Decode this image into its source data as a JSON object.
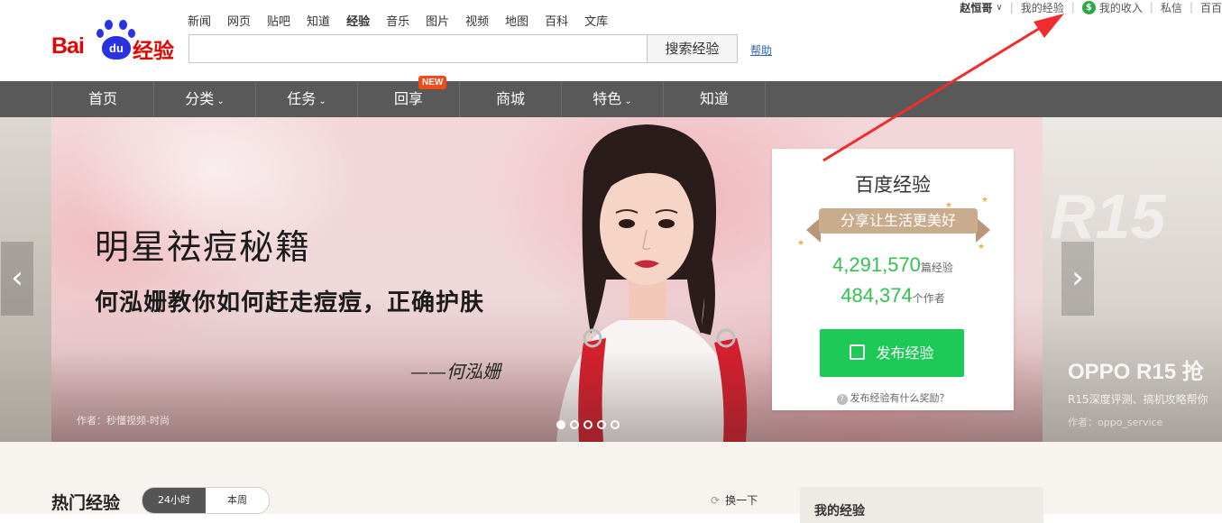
{
  "header": {
    "logo": {
      "part1": "Bai",
      "part2": "du",
      "part3": "经验"
    },
    "top_nav": [
      "新闻",
      "网页",
      "贴吧",
      "知道",
      "经验",
      "音乐",
      "图片",
      "视频",
      "地图",
      "百科",
      "文库"
    ],
    "active_top_nav": "经验",
    "search": {
      "value": "",
      "placeholder": "",
      "button": "搜索经验"
    },
    "help_link": "帮助",
    "user": {
      "name": "赵恒哥",
      "my_experience": "我的经验",
      "my_income": "我的收入",
      "messages": "私信",
      "baidu": "百百"
    }
  },
  "main_nav": {
    "items": [
      "首页",
      "分类",
      "任务",
      "回享",
      "商城",
      "特色",
      "知道"
    ],
    "new_badge": "NEW"
  },
  "banner": {
    "headline": "明星祛痘秘籍",
    "subline": "何泓姗教你如何赶走痘痘，正确护肤",
    "signature": "——何泓姗",
    "author": "作者：秒懂视频-时尚",
    "side_right": {
      "title": "OPPO R15 抢",
      "subtitle": "R15深度评测、搞机攻略帮你",
      "author": "作者：oppo_service",
      "watermark": "R15"
    }
  },
  "stats_card": {
    "title": "百度经验",
    "ribbon": "分享让生活更美好",
    "articles_count": "4,291,570",
    "articles_unit": "篇经验",
    "authors_count": "484,374",
    "authors_unit": "个作者",
    "publish_button": "发布经验",
    "reward_link": "发布经验有什么奖励？"
  },
  "lower": {
    "hot_title": "热门经验",
    "tabs": [
      "24小时",
      "本周"
    ],
    "refresh": "换一下",
    "my_box_title": "我的经验"
  },
  "colors": {
    "brand_red": "#e10602",
    "brand_blue": "#2932e1",
    "green": "#1dca57",
    "nav_bg": "#595959",
    "annotation": "#ee2d2d"
  }
}
